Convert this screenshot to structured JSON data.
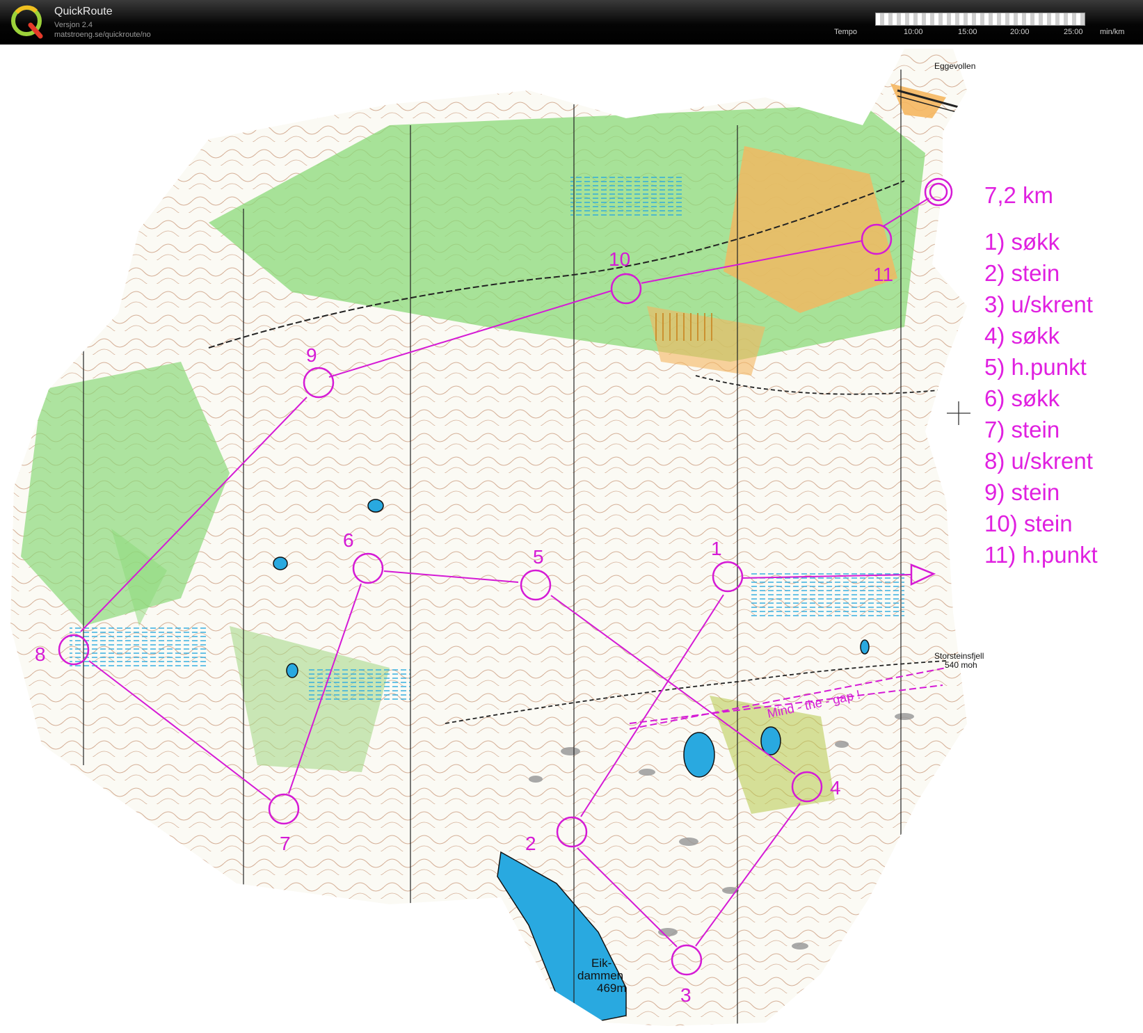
{
  "app": {
    "name": "QuickRoute",
    "version": "Versjon 2.4",
    "url": "matstroeng.se/quickroute/no"
  },
  "tempo": {
    "label": "Tempo",
    "ticks": [
      "10:00",
      "15:00",
      "20:00",
      "25:00"
    ],
    "unit": "min/km"
  },
  "colors": {
    "course": "#d51ad5",
    "water": "#29a9e0",
    "forest": "#8bd97a",
    "open": "#f5b65f",
    "contour": "#a0522d"
  },
  "course": {
    "distance": "7,2 km",
    "controls": [
      "1) søkk",
      "2) stein",
      "3) u/skrent",
      "4) søkk",
      "5) h.punkt",
      "6) søkk",
      "7) stein",
      "8) u/skrent",
      "9) stein",
      "10) stein",
      "11) h.punkt"
    ],
    "control_numbers": [
      "1",
      "2",
      "3",
      "4",
      "5",
      "6",
      "7",
      "8",
      "9",
      "10",
      "11"
    ]
  },
  "map_labels": {
    "eggevollen": "Eggevollen",
    "summit_name": "Storsteinsfjell",
    "summit_height": "540 moh",
    "gap_note": "Mind - the - gap !",
    "lake_line1": "Eik-",
    "lake_line2": "dammen",
    "lake_line3": "469m"
  }
}
